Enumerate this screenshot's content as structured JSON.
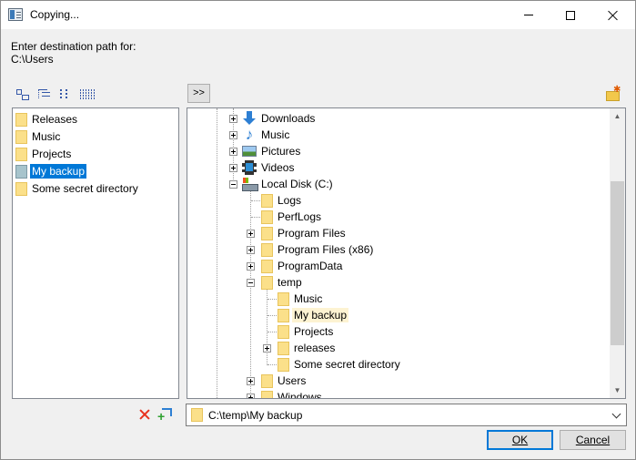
{
  "window": {
    "title": "Copying..."
  },
  "prompt": {
    "line1": "Enter destination path for:",
    "line2": "C:\\Users"
  },
  "toolbar": {
    "expand_label": ">>"
  },
  "left_list": {
    "items": [
      {
        "label": "Releases",
        "selected": false
      },
      {
        "label": "Music",
        "selected": false
      },
      {
        "label": "Projects",
        "selected": false
      },
      {
        "label": "My backup",
        "selected": true
      },
      {
        "label": "Some secret directory",
        "selected": false
      }
    ]
  },
  "tree": {
    "items": [
      {
        "label": "Downloads",
        "icon": "download-icon"
      },
      {
        "label": "Music",
        "icon": "music-icon"
      },
      {
        "label": "Pictures",
        "icon": "pictures-icon"
      },
      {
        "label": "Videos",
        "icon": "videos-icon"
      },
      {
        "label": "Local Disk (C:)",
        "icon": "disk-icon"
      },
      {
        "label": "Logs",
        "icon": "folder-icon"
      },
      {
        "label": "PerfLogs",
        "icon": "folder-icon"
      },
      {
        "label": "Program Files",
        "icon": "folder-icon"
      },
      {
        "label": "Program Files (x86)",
        "icon": "folder-icon"
      },
      {
        "label": "ProgramData",
        "icon": "folder-icon"
      },
      {
        "label": "temp",
        "icon": "folder-icon"
      },
      {
        "label": "Music",
        "icon": "folder-icon"
      },
      {
        "label": "My backup",
        "icon": "folder-icon",
        "selected": true
      },
      {
        "label": "Projects",
        "icon": "folder-icon"
      },
      {
        "label": "releases",
        "icon": "folder-icon"
      },
      {
        "label": "Some secret directory",
        "icon": "folder-icon"
      },
      {
        "label": "Users",
        "icon": "folder-icon"
      },
      {
        "label": "Windows",
        "icon": "folder-icon"
      }
    ]
  },
  "path": {
    "value": "C:\\temp\\My backup"
  },
  "buttons": {
    "ok": "OK",
    "cancel": "Cancel"
  },
  "colors": {
    "selection": "#0078d7",
    "folder": "#fbe08a",
    "tree_selection": "#fdf3d2"
  }
}
